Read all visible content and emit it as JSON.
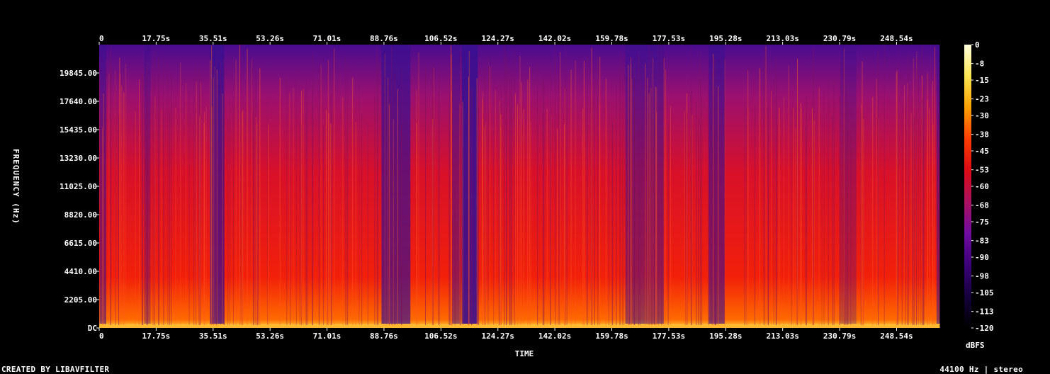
{
  "chart_data": {
    "type": "heatmap",
    "x_axis": {
      "label": "TIME",
      "unit": "s",
      "ticks": [
        "0",
        "17.75s",
        "35.51s",
        "53.26s",
        "71.01s",
        "88.76s",
        "106.52s",
        "124.27s",
        "142.02s",
        "159.78s",
        "177.53s",
        "195.28s",
        "213.03s",
        "230.79s",
        "248.54s"
      ],
      "tick_values": [
        0,
        17.75,
        35.51,
        53.26,
        71.01,
        88.76,
        106.52,
        124.27,
        142.02,
        159.78,
        177.53,
        195.28,
        213.03,
        230.79,
        248.54
      ],
      "range": [
        0,
        265
      ]
    },
    "y_axis": {
      "label": "FREQUENCY (Hz)",
      "unit": "Hz",
      "ticks": [
        "DC",
        "2205.00",
        "4410.00",
        "6615.00",
        "8820.00",
        "11025.00",
        "13230.00",
        "15435.00",
        "17640.00",
        "19845.00"
      ],
      "tick_values": [
        0,
        2205,
        4410,
        6615,
        8820,
        11025,
        13230,
        15435,
        17640,
        19845
      ],
      "range": [
        0,
        22050
      ]
    },
    "colorbar": {
      "label": "dBFS",
      "ticks": [
        "0",
        "-8",
        "-15",
        "-23",
        "-30",
        "-38",
        "-45",
        "-53",
        "-60",
        "-68",
        "-75",
        "-83",
        "-90",
        "-98",
        "-105",
        "-113",
        "-120"
      ],
      "range": [
        -120,
        0
      ],
      "colors": [
        "#000000",
        "#14003c",
        "#3c0078",
        "#6e0ca0",
        "#aa1060",
        "#dc0a14",
        "#ff3c00",
        "#ffa000",
        "#ffe650",
        "#ffffe0"
      ]
    },
    "footer_left": "CREATED BY LIBAVFILTER",
    "footer_right": "44100 Hz | stereo"
  }
}
